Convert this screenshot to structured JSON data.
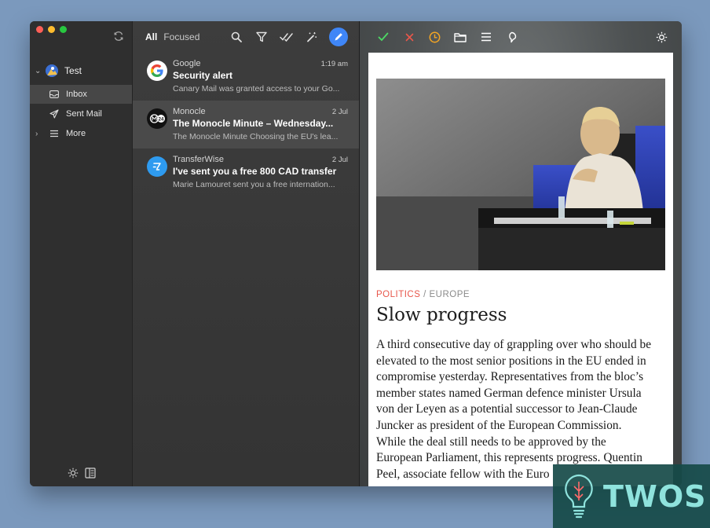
{
  "sidebar": {
    "account": "Test",
    "items": [
      {
        "label": "Inbox",
        "icon": "inbox-icon"
      },
      {
        "label": "Sent Mail",
        "icon": "paper-plane-icon"
      },
      {
        "label": "More",
        "icon": "list-icon"
      }
    ]
  },
  "list": {
    "tabs": {
      "all": "All",
      "focused": "Focused"
    },
    "messages": [
      {
        "sender": "Google",
        "date": "1:19 am",
        "subject": "Security alert",
        "preview": "Canary Mail was granted access to your Go..."
      },
      {
        "sender": "Monocle",
        "date": "2 Jul",
        "subject": "The Monocle Minute – Wednesday...",
        "preview": "The Monocle Minute Choosing the EU's lea..."
      },
      {
        "sender": "TransferWise",
        "date": "2 Jul",
        "subject": "I've sent you a free 800 CAD transfer",
        "preview": "Marie Lamouret sent you a free internation..."
      }
    ]
  },
  "reader": {
    "kicker_section": "POLITICS",
    "kicker_sep": " / ",
    "kicker_sub": "EUROPE",
    "headline": "Slow progress",
    "lines": [
      "A third consecutive day of grappling over who should be",
      "elevated to the most senior positions in the EU ended in",
      "compromise yesterday. Representatives from the bloc’s",
      "member states named German defence minister Ursula",
      "von der Leyen as a potential successor to Jean-Claude",
      "Juncker as president of the European Commission.",
      "While the deal still needs to be approved by the",
      "European Parliament, this represents progress. Quentin",
      "Peel, associate fellow with the Euro"
    ]
  },
  "watermark": {
    "text": "TWOS"
  },
  "colors": {
    "accent": "#3f86f7",
    "kicker": "#e8574b"
  }
}
